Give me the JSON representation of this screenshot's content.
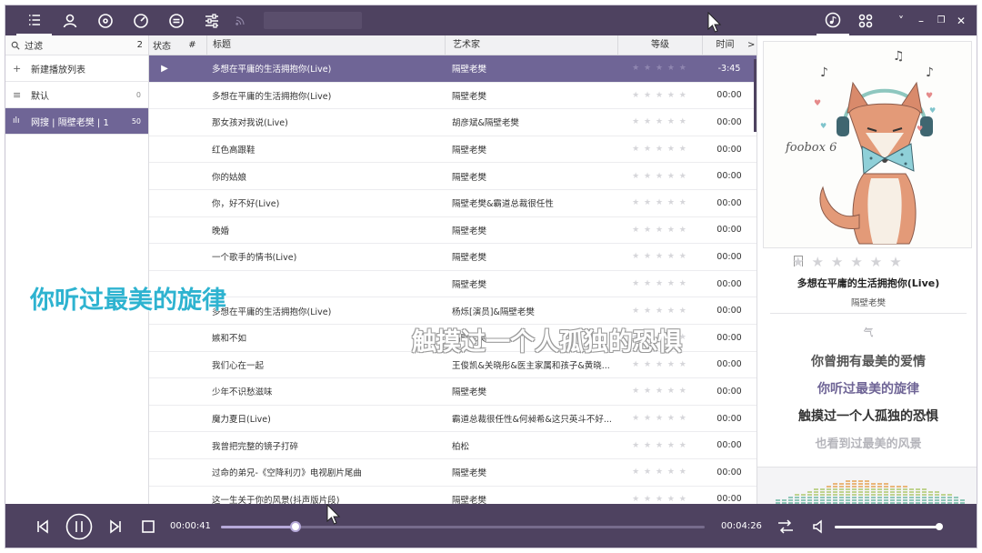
{
  "colors": {
    "accent": "#6f6596",
    "bar": "#4e4260",
    "subtitle_left": "#2eb3d0"
  },
  "topbar": {
    "left_icons": [
      "playlist-icon",
      "artist-icon",
      "album-icon",
      "dashboard-icon",
      "equalizer-icon",
      "settings-sliders-icon",
      "rss-icon"
    ],
    "right_icons": [
      "music-note-icon",
      "grid-icon"
    ],
    "window_controls": [
      "˅",
      "–",
      "❐",
      "✕"
    ]
  },
  "sidebar": {
    "filter": {
      "label": "过滤",
      "count": "2"
    },
    "items": [
      {
        "icon": "+",
        "label": "新建播放列表",
        "count": ""
      },
      {
        "icon": "≡",
        "label": "默认",
        "count": "0"
      },
      {
        "icon": "ılı",
        "label": "网搜 | 隔壁老樊 | 1",
        "count": "50"
      }
    ]
  },
  "playlist": {
    "headers": {
      "status": "状态",
      "num": "#",
      "title": "标题",
      "artist": "艺术家",
      "rating": "等级",
      "time": "时间",
      "more": ">"
    },
    "rows": [
      {
        "title": "多想在平庸的生活拥抱你(Live)",
        "artist": "隔壁老樊",
        "time": "-3:45",
        "playing": true
      },
      {
        "title": "多想在平庸的生活拥抱你(Live)",
        "artist": "隔壁老樊",
        "time": "00:00"
      },
      {
        "title": "那女孩对我说(Live)",
        "artist": "胡彦斌&隔壁老樊",
        "time": "00:00"
      },
      {
        "title": "红色高跟鞋",
        "artist": "隔壁老樊",
        "time": "00:00"
      },
      {
        "title": "你的姑娘",
        "artist": "隔壁老樊",
        "time": "00:00"
      },
      {
        "title": "你，好不好(Live)",
        "artist": "隔壁老樊&霸道总裁很任性",
        "time": "00:00"
      },
      {
        "title": "晚婚",
        "artist": "隔壁老樊",
        "time": "00:00"
      },
      {
        "title": "一个歌手的情书(Live)",
        "artist": "隔壁老樊",
        "time": "00:00"
      },
      {
        "title": "",
        "artist": "隔壁老樊",
        "time": "00:00"
      },
      {
        "title": "多想在平庸的生活拥抱你(Live)",
        "artist": "杨烁[演员]&隔壁老樊",
        "time": "00:00"
      },
      {
        "title": "嫉和不如",
        "artist": "隔壁老樊",
        "time": "00:00"
      },
      {
        "title": "我们心在一起",
        "artist": "王俊凯&关晓彤&医主家属和孩子&黄晓...",
        "time": "00:00"
      },
      {
        "title": "少年不识愁滋味",
        "artist": "隔壁老樊",
        "time": "00:00"
      },
      {
        "title": "魔力夏日(Live)",
        "artist": "霸道总裁很任性&何昶希&这只英斗不好...",
        "time": "00:00"
      },
      {
        "title": "我曾把完整的镜子打碎",
        "artist": "柏松",
        "time": "00:00"
      },
      {
        "title": "过命的弟兄-《空降利刃》电视剧片尾曲",
        "artist": "隔壁老樊",
        "time": "00:00"
      },
      {
        "title": "这一生关于你的风景(抖声版片段)",
        "artist": "隔壁老樊",
        "time": "00:00"
      }
    ]
  },
  "now_playing": {
    "cover_text": "foobox 6",
    "title": "多想在平庸的生活拥抱你(Live)",
    "artist": "隔壁老樊",
    "lyrics": [
      "气",
      "你曾拥有最美的爱情",
      "你听过最美的旋律",
      "触摸过一个人孤独的恐惧",
      "也看到过最美的风景"
    ]
  },
  "player": {
    "elapsed": "00:00:41",
    "total": "00:04:26",
    "progress": 0.154,
    "volume": 0.99
  },
  "overlay": {
    "subtitle_left": "你听过最美的旋律",
    "subtitle_center": "触摸过一个人孤独的恐惧"
  }
}
